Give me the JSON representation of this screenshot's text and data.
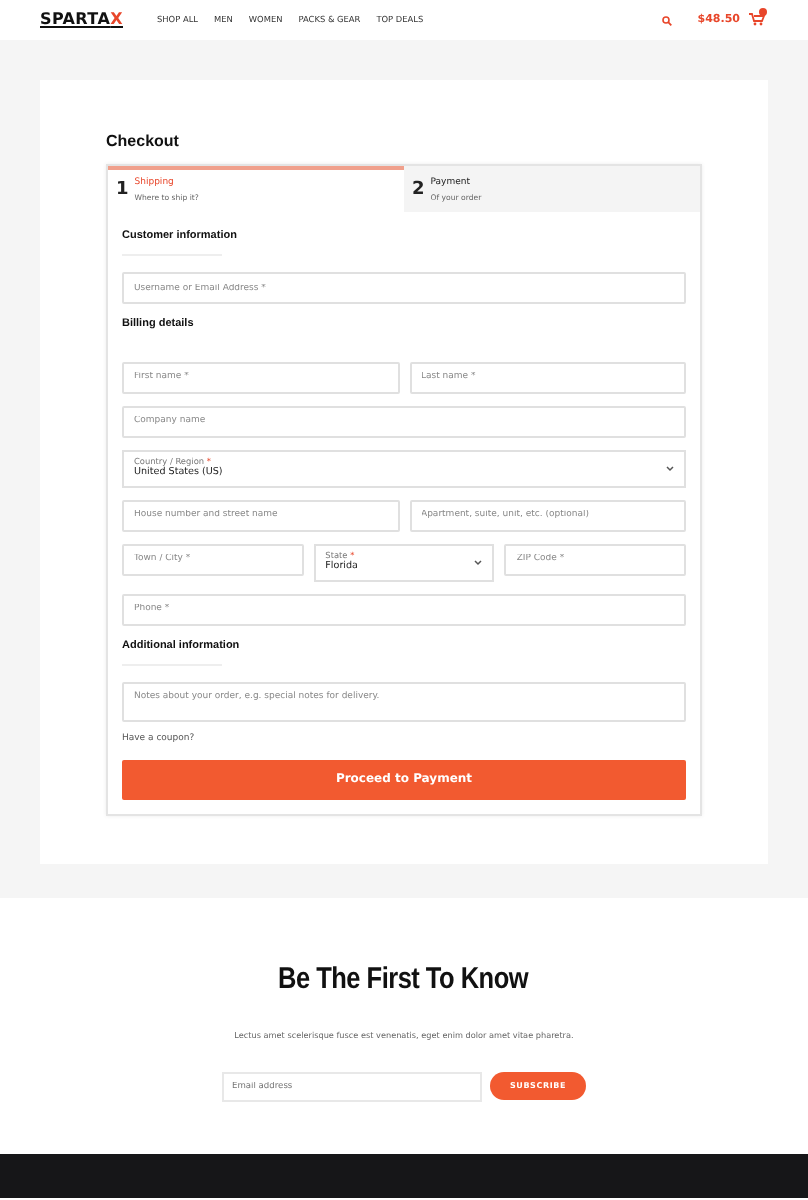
{
  "header": {
    "logo": {
      "main": "SPARTA",
      "accent": "X"
    },
    "nav": [
      {
        "label": "SHOP ALL"
      },
      {
        "label": "MEN"
      },
      {
        "label": "WOMEN"
      },
      {
        "label": "PACKS & GEAR"
      },
      {
        "label": "TOP DEALS"
      }
    ],
    "cart_total": "$48.50"
  },
  "checkout": {
    "title": "Checkout",
    "steps": [
      {
        "number": "1",
        "title": "Shipping",
        "subtitle": "Where to ship it?",
        "selected": true
      },
      {
        "number": "2",
        "title": "Payment",
        "subtitle": "Of your order",
        "selected": false
      }
    ],
    "sections": [
      {
        "heading": "Customer information",
        "underline": true,
        "rows": [
          [
            {
              "kind": "input",
              "placeholder": "Username or Email Address *"
            }
          ]
        ]
      },
      {
        "heading": "Billing details",
        "underline": false,
        "rows": [
          [
            {
              "kind": "input",
              "placeholder": "First name *"
            },
            {
              "kind": "input",
              "placeholder": "Last name *"
            }
          ],
          [
            {
              "kind": "input",
              "placeholder": "Company name"
            }
          ],
          [
            {
              "kind": "select",
              "label": "Country / Region",
              "required_mark": "*",
              "value": "United States (US)"
            }
          ],
          [
            {
              "kind": "input",
              "placeholder": "House number and street name"
            },
            {
              "kind": "input",
              "placeholder": "Apartment, suite, unit, etc. (optional)"
            }
          ],
          [
            {
              "kind": "input",
              "placeholder": "Town / City *"
            },
            {
              "kind": "select",
              "label": "State",
              "required_mark": "*",
              "value": "Florida"
            },
            {
              "kind": "input",
              "placeholder": "ZIP Code *"
            }
          ],
          [
            {
              "kind": "input",
              "placeholder": "Phone *"
            }
          ]
        ]
      },
      {
        "heading": "Additional information",
        "underline": true,
        "rows": [
          [
            {
              "kind": "textarea",
              "placeholder": "Notes about your order, e.g. special notes for delivery."
            }
          ]
        ]
      }
    ],
    "coupon_link": "Have a coupon?",
    "submit": "Proceed to Payment"
  },
  "newsletter": {
    "title": "Be The First To Know",
    "text": "Lectus amet scelerisque fusce est venenatis, eget enim dolor amet vitae pharetra.",
    "email_placeholder": "Email address",
    "button": "SUBSCRIBE"
  }
}
